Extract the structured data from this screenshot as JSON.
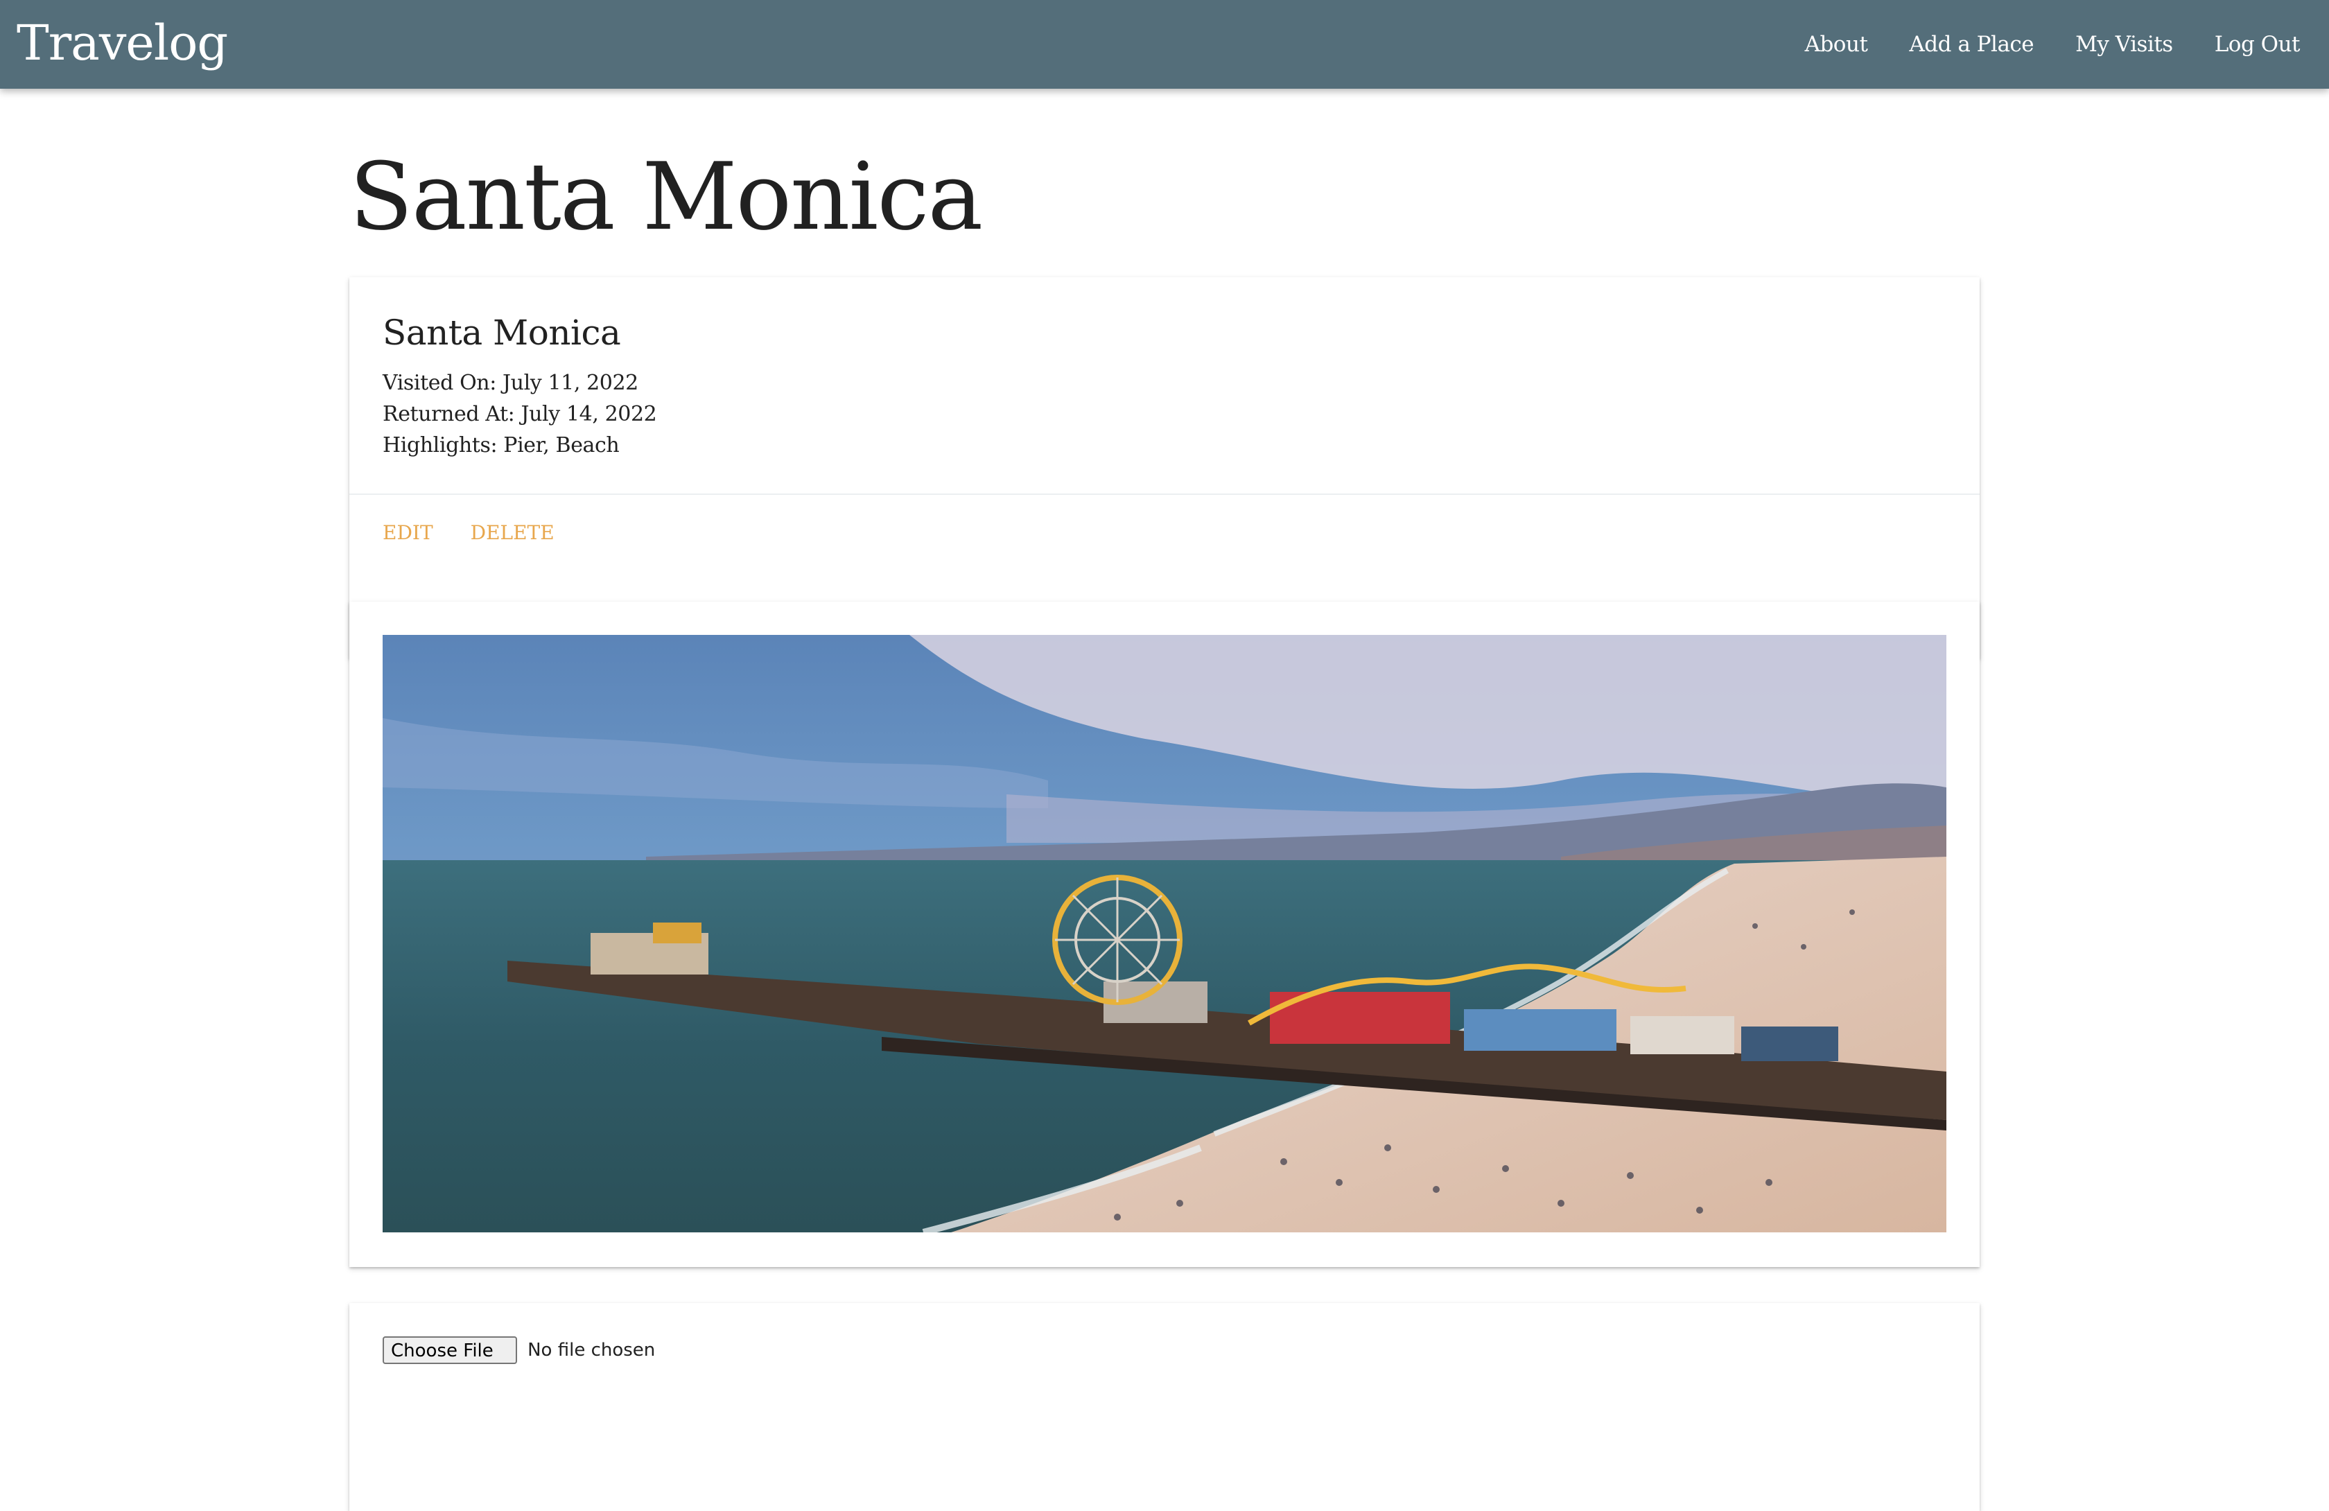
{
  "app": {
    "brand": "Travelog"
  },
  "nav": {
    "links": [
      "About",
      "Add a Place",
      "My Visits",
      "Log Out"
    ]
  },
  "page": {
    "title": "Santa Monica"
  },
  "place_card": {
    "title": "Santa Monica",
    "visited_on": "Visited On: July 11, 2022",
    "returned_at": "Returned At: July 14, 2022",
    "highlights": "Highlights: Pier, Beach",
    "actions": {
      "edit": "EDIT",
      "delete": "DELETE"
    },
    "accent_color": "#e8a74d"
  },
  "photo_card": {
    "photo_subject": "Aerial view of Santa Monica Pier with Ferris wheel and roller coaster, the beach, ocean and coastline under a cloudy sky"
  },
  "upload_card": {
    "button_label": "Choose File",
    "status_text": "No file chosen"
  },
  "colors": {
    "navbar": "#546e7a",
    "action_links": "#e8a74d"
  }
}
